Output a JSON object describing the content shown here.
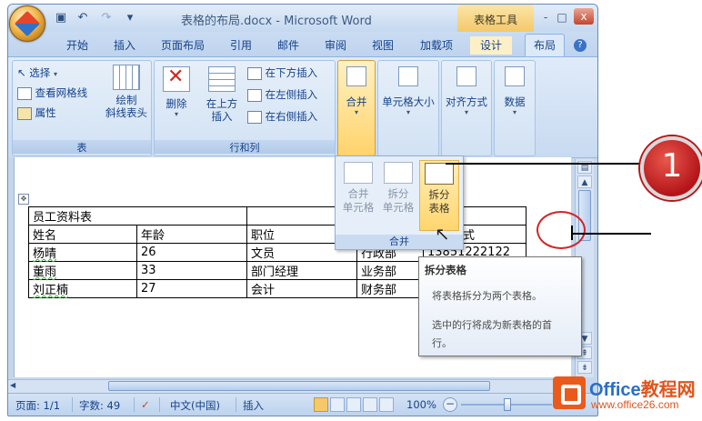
{
  "window": {
    "title": "表格的布局.docx - Microsoft Word",
    "context_tools": "表格工具",
    "minimize": "-",
    "maximize": "□",
    "close": "x"
  },
  "qat": {
    "save_icon": "save-icon",
    "undo": "↶",
    "redo": "↷",
    "customize": "▾"
  },
  "tabs": [
    {
      "label": "开始"
    },
    {
      "label": "插入"
    },
    {
      "label": "页面布局"
    },
    {
      "label": "引用"
    },
    {
      "label": "邮件"
    },
    {
      "label": "审阅"
    },
    {
      "label": "视图"
    },
    {
      "label": "加载项"
    },
    {
      "label": "设计"
    },
    {
      "label": "布局"
    }
  ],
  "help": "?",
  "ribbon": {
    "table_group": {
      "label": "表",
      "select": "选择",
      "view_gridlines": "查看网格线",
      "properties": "属性",
      "draw_diagonal_line1": "绘制",
      "draw_diagonal_line2": "斜线表头"
    },
    "rows_cols_group": {
      "label": "行和列",
      "delete": "删除",
      "insert_above_1": "在上方",
      "insert_above_2": "插入",
      "insert_below": "在下方插入",
      "insert_left": "在左侧插入",
      "insert_right": "在右侧插入"
    },
    "merge": "合并",
    "cell_size": "单元格大小",
    "alignment": "对齐方式",
    "data": "数据"
  },
  "merge_gallery": {
    "label": "合并",
    "items": [
      {
        "line1": "合并",
        "line2": "单元格"
      },
      {
        "line1": "拆分",
        "line2": "单元格"
      },
      {
        "line1": "拆分",
        "line2": "表格"
      }
    ]
  },
  "document": {
    "table_title": "员工资料表",
    "header": [
      "姓名",
      "年龄",
      "职位",
      "",
      "联系方式"
    ],
    "rows": [
      [
        "杨晴",
        "26",
        "文员",
        "行政部",
        "13851222122"
      ],
      [
        "董雨",
        "33",
        "部门经理",
        "业务部",
        ""
      ],
      [
        "刘正楠",
        "27",
        "会计",
        "财务部",
        ""
      ]
    ]
  },
  "tooltip": {
    "title": "拆分表格",
    "line1": "将表格拆分为两个表格。",
    "line2a": "选中的行将成为新表格的首",
    "line2b": "行。"
  },
  "statusbar": {
    "page": "页面: 1/1",
    "words": "字数: 49",
    "language": "中文(中国)",
    "mode": "插入",
    "zoom": "100%",
    "zoom_out": "−"
  },
  "callout": {
    "number": "1"
  },
  "watermark": {
    "brand_en": "Office",
    "brand_cn": "教程网",
    "url": "www.office26.com"
  },
  "colors": {
    "accent": "#15428b",
    "context_tab": "#f5c86a",
    "callout": "#b5151a"
  }
}
